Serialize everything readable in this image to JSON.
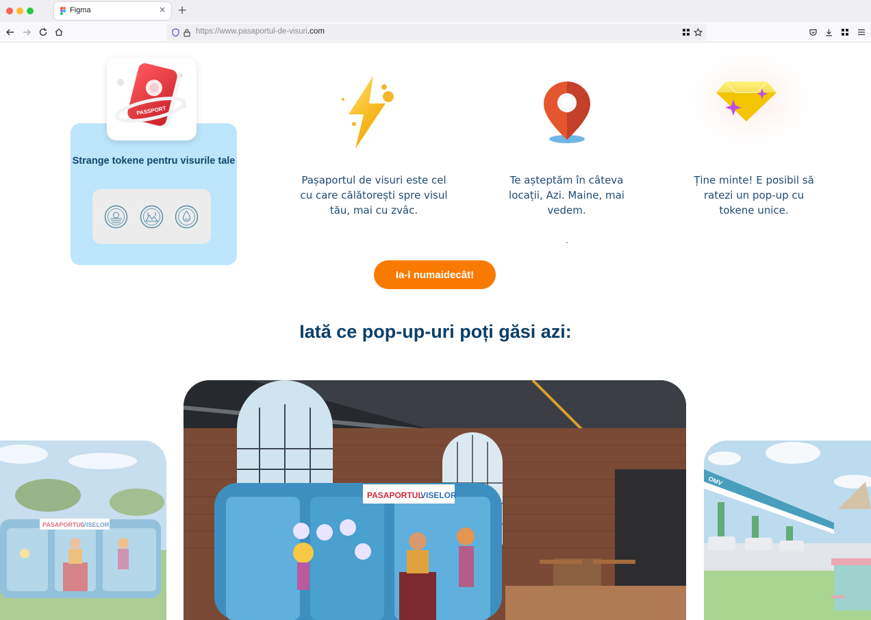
{
  "browser": {
    "tab_title": "Figma",
    "tab_close": "×",
    "new_tab": "+",
    "url_prefix": "https://www.pasaportul-de-visuri",
    "url_domain_suffix": ".com"
  },
  "tokens_card": {
    "title": "Strange tokene pentru visurile tale",
    "passport_label": "PASSPORT",
    "seals": [
      "seal-sun-icon",
      "seal-mountain-icon",
      "seal-drop-icon"
    ]
  },
  "features": [
    {
      "icon": "lightning-icon",
      "text": "Pașaportul de visuri este cel cu care călătorești spre visul tău, mai cu zvâc."
    },
    {
      "icon": "location-pin-icon",
      "text": "Te așteptăm în câteva locații, Azi. Maine, mai vedem."
    },
    {
      "icon": "diamond-icon",
      "text": "Ține minte! E posibil să ratezi un pop-up cu tokene unice."
    }
  ],
  "dot_mark": ".",
  "cta_label": "Ia-l numaidecât!",
  "popups_title": "Iată ce pop-up-uri poți găsi azi:",
  "photos": {
    "booth_sign_brand": "PASAPORTUL",
    "booth_sign_accent": "VISELOR",
    "station_brand": "OMV"
  },
  "colors": {
    "accent_orange": "#f97a00",
    "heading_blue": "#0b3f68",
    "card_blue": "#bde5fb"
  }
}
